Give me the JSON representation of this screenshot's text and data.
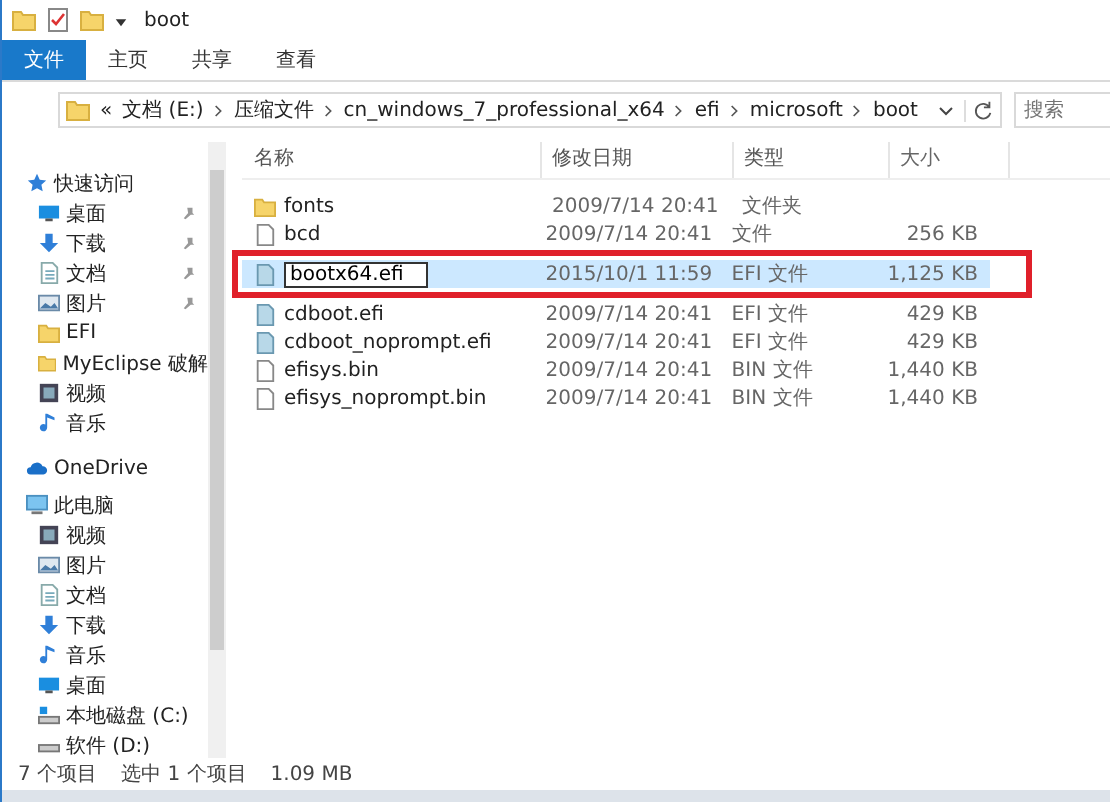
{
  "window": {
    "title": "boot"
  },
  "ribbon_tabs": [
    {
      "label": "文件",
      "kind": "menu",
      "selected": false
    },
    {
      "label": "主页",
      "kind": "tab",
      "selected": false
    },
    {
      "label": "共享",
      "kind": "tab",
      "selected": false
    },
    {
      "label": "查看",
      "kind": "tab",
      "selected": false
    }
  ],
  "address_bar": {
    "overflow": "«",
    "path": [
      "文档 (E:)",
      "压缩文件",
      "cn_windows_7_professional_x64",
      "efi",
      "microsoft",
      "boot"
    ]
  },
  "search": {
    "placeholder": "搜索"
  },
  "sidebar": {
    "items": [
      {
        "label": "快速访问",
        "kind": "star",
        "pinned": false,
        "children": [
          {
            "label": "桌面",
            "kind": "desktop",
            "pinned": true
          },
          {
            "label": "下载",
            "kind": "download",
            "pinned": true
          },
          {
            "label": "文档",
            "kind": "document",
            "pinned": true
          },
          {
            "label": "图片",
            "kind": "picture",
            "pinned": true
          },
          {
            "label": "EFI",
            "kind": "folder",
            "pinned": false
          },
          {
            "label": "MyEclipse 破解",
            "kind": "folder",
            "pinned": false
          },
          {
            "label": "视频",
            "kind": "video",
            "pinned": false
          },
          {
            "label": "音乐",
            "kind": "music",
            "pinned": false
          }
        ]
      },
      {
        "label": "OneDrive",
        "kind": "cloud",
        "pinned": false
      },
      {
        "label": "此电脑",
        "kind": "computer",
        "pinned": false,
        "children": [
          {
            "label": "视频",
            "kind": "video",
            "pinned": false
          },
          {
            "label": "图片",
            "kind": "picture",
            "pinned": false
          },
          {
            "label": "文档",
            "kind": "document",
            "pinned": false
          },
          {
            "label": "下载",
            "kind": "download",
            "pinned": false
          },
          {
            "label": "音乐",
            "kind": "music",
            "pinned": false
          },
          {
            "label": "桌面",
            "kind": "desktop",
            "pinned": false
          },
          {
            "label": "本地磁盘 (C:)",
            "kind": "system-drive",
            "pinned": false
          },
          {
            "label": "软件 (D:)",
            "kind": "drive",
            "pinned": false
          }
        ]
      }
    ]
  },
  "table": {
    "columns": [
      "名称",
      "修改日期",
      "类型",
      "大小"
    ],
    "rows": [
      {
        "kind": "folder",
        "name": "fonts",
        "date": "2009/7/14 20:41",
        "type": "文件夹",
        "selected": false,
        "editing": false,
        "outlined": false
      },
      {
        "kind": "file",
        "name": "bcd",
        "date": "2009/7/14 20:41",
        "type": "文件",
        "size": "256 KB",
        "selected": false,
        "editing": false,
        "outlined": false
      },
      {
        "kind": "efi",
        "name": "bootx64.efi",
        "date": "2015/10/1 11:59",
        "type": "EFI 文件",
        "size": "1,125 KB",
        "selected": true,
        "editing": true,
        "outlined": true
      },
      {
        "kind": "efi",
        "name": "cdboot.efi",
        "date": "2009/7/14 20:41",
        "type": "EFI 文件",
        "size": "429 KB",
        "selected": false,
        "editing": false,
        "outlined": false
      },
      {
        "kind": "efi",
        "name": "cdboot_noprompt.efi",
        "date": "2009/7/14 20:41",
        "type": "EFI 文件",
        "size": "429 KB",
        "selected": false,
        "editing": false,
        "outlined": false
      },
      {
        "kind": "file",
        "name": "efisys.bin",
        "date": "2009/7/14 20:41",
        "type": "BIN 文件",
        "size": "1,440 KB",
        "selected": false,
        "editing": false,
        "outlined": false
      },
      {
        "kind": "file",
        "name": "efisys_noprompt.bin",
        "date": "2009/7/14 20:41",
        "type": "BIN 文件",
        "size": "1,440 KB",
        "selected": false,
        "editing": false,
        "outlined": false
      }
    ]
  },
  "status_bar": {
    "count": "7 个项目",
    "selection": "选中 1 个项目",
    "size": "1.09 MB"
  }
}
